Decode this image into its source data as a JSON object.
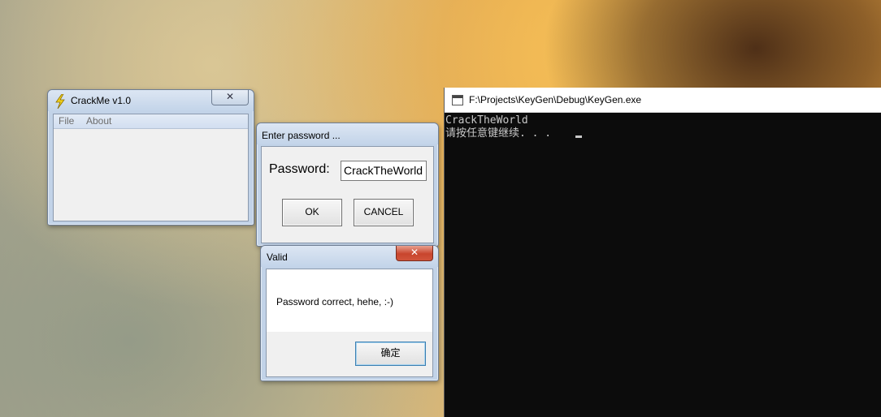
{
  "crackme": {
    "title": "CrackMe v1.0",
    "close_glyph": "✕",
    "menu": [
      {
        "label": "File"
      },
      {
        "label": "About"
      }
    ]
  },
  "password_dialog": {
    "title": "Enter password ...",
    "label": "Password:",
    "input_value": "CrackTheWorld",
    "ok_label": "OK",
    "cancel_label": "CANCEL"
  },
  "valid_dialog": {
    "title": "Valid",
    "message": "Password correct, hehe, :-)",
    "confirm_label": "确定",
    "close_glyph": "✕"
  },
  "console": {
    "title": "F:\\Projects\\KeyGen\\Debug\\KeyGen.exe",
    "lines": [
      "CrackTheWorld",
      "请按任意键继续. . ."
    ]
  },
  "colors": {
    "console_bg": "#0c0c0c",
    "console_text": "#c8c8c8",
    "close_red": "#c8452d",
    "window_frame": "#c2d3e8"
  },
  "icons": {
    "crackme_app": "lightning-bolt-icon",
    "console_app": "console-window-icon"
  }
}
